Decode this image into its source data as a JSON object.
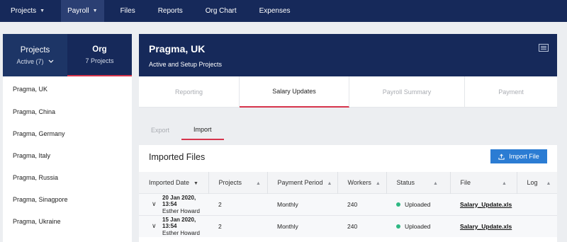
{
  "nav": {
    "items": [
      {
        "label": "Projects",
        "caret": true,
        "active": false
      },
      {
        "label": "Payroll",
        "caret": true,
        "active": true
      },
      {
        "label": "Files",
        "caret": false,
        "active": false
      },
      {
        "label": "Reports",
        "caret": false,
        "active": false
      },
      {
        "label": "Org Chart",
        "caret": false,
        "active": false
      },
      {
        "label": "Expenses",
        "caret": false,
        "active": false
      }
    ]
  },
  "sidebar": {
    "tabs": {
      "projects": {
        "label": "Projects",
        "sub": "Active (7)"
      },
      "org": {
        "label": "Org",
        "sub": "7 Projects"
      }
    },
    "items": [
      {
        "label": "Pragma, UK"
      },
      {
        "label": "Pragma, China"
      },
      {
        "label": "Pragma, Germany"
      },
      {
        "label": "Pragma, Italy"
      },
      {
        "label": "Pragma, Russia"
      },
      {
        "label": "Pragma, Sinagpore"
      },
      {
        "label": "Pragma, Ukraine"
      }
    ]
  },
  "header": {
    "title": "Pragma, UK",
    "subtitle": "Active and Setup Projects"
  },
  "tabs": [
    {
      "label": "Reporting",
      "active": false
    },
    {
      "label": "Salary Updates",
      "active": true
    },
    {
      "label": "Payroll Summary",
      "active": false
    },
    {
      "label": "Payment",
      "active": false
    }
  ],
  "subtabs": [
    {
      "label": "Export",
      "active": false
    },
    {
      "label": "Import",
      "active": true
    }
  ],
  "files": {
    "title": "Imported Files",
    "import_button": "Import File",
    "columns": [
      "Imported Date",
      "Projects",
      "Payment Period",
      "Workers",
      "Status",
      "File",
      "Log"
    ],
    "rows": [
      {
        "date": "20 Jan 2020, 13:54",
        "user": "Esther Howard",
        "projects": "2",
        "period": "Monthly",
        "workers": "240",
        "status": "Uploaded",
        "file": "Salary_Update.xls",
        "log": ""
      },
      {
        "date": "15 Jan 2020, 13:54",
        "user": "Esther Howard",
        "projects": "2",
        "period": "Monthly",
        "workers": "240",
        "status": "Uploaded",
        "file": "Salary_Update.xls",
        "log": ""
      }
    ]
  },
  "colors": {
    "navy": "#16295a",
    "accent_red": "#d6344c",
    "button_blue": "#2b7cd3",
    "status_green": "#2fb883"
  }
}
